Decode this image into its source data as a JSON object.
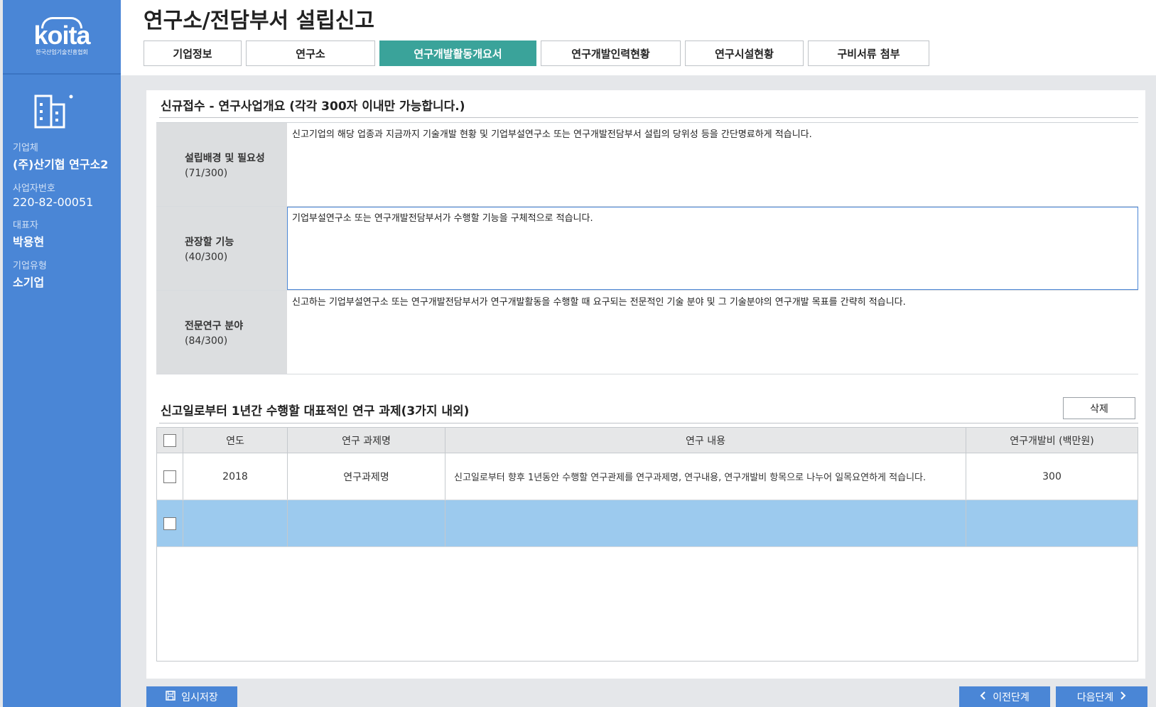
{
  "sidebar": {
    "logo_text": "koita",
    "logo_sub": "한국산업기술진흥협회",
    "company_label": "기업체",
    "company_value": "(주)산기협 연구소2",
    "bizno_label": "사업자번호",
    "bizno_value": "220-82-00051",
    "ceo_label": "대표자",
    "ceo_value": "박용현",
    "type_label": "기업유형",
    "type_value": "소기업"
  },
  "header": {
    "title": "연구소/전담부서 설립신고",
    "tabs": [
      {
        "label": "기업정보",
        "active": false
      },
      {
        "label": "연구소",
        "active": false
      },
      {
        "label": "연구개발활동개요서",
        "active": true
      },
      {
        "label": "연구개발인력현황",
        "active": false
      },
      {
        "label": "연구시설현황",
        "active": false
      },
      {
        "label": "구비서류 첨부",
        "active": false
      }
    ]
  },
  "overview": {
    "title": "신규접수 - 연구사업개요 (각각 300자 이내만 가능합니다.)",
    "rows": [
      {
        "name": "설립배경 및 필요성",
        "count": "(71/300)",
        "text": "신고기업의 해당 업종과 지금까지 기술개발 현황 및 기업부설연구소 또는 연구개발전담부서 설립의 당위성 등을 간단명료하게 적습니다."
      },
      {
        "name": "관장할 기능",
        "count": "(40/300)",
        "text": "기업부설연구소 또는 연구개발전담부서가 수행할 기능을 구체적으로 적습니다."
      },
      {
        "name": "전문연구 분야",
        "count": "(84/300)",
        "text": "신고하는 기업부설연구소 또는 연구개발전담부서가 연구개발활동을 수행할 때 요구되는 전문적인 기술 분야 및 그 기술분야의 연구개발 목표를 간략히 적습니다."
      }
    ]
  },
  "projects": {
    "title": "신고일로부터 1년간 수행할 대표적인 연구 과제(3가지 내외)",
    "delete_label": "삭제",
    "headers": {
      "year": "연도",
      "name": "연구 과제명",
      "content": "연구 내용",
      "cost": "연구개발비 (백만원)"
    },
    "rows": [
      {
        "year": "2018",
        "name": "연구과제명",
        "content": "신고일로부터 향후 1년동안 수행할 연구관제를 연구과제명, 연구내용, 연구개발비 항목으로 나누어 일목요연하게 적습니다.",
        "cost": "300"
      },
      {
        "year": "",
        "name": "",
        "content": "",
        "cost": ""
      }
    ]
  },
  "footer": {
    "save_label": "임시저장",
    "prev_label": "이전단계",
    "next_label": "다음단계"
  },
  "colors": {
    "sidebar": "#4a86d6",
    "active_tab": "#3aa39a",
    "selected_row": "#9ccaee"
  }
}
